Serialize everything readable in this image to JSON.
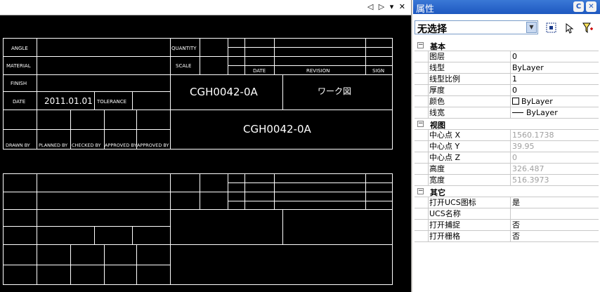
{
  "canvas": {
    "controls": "◁ ▷ ▾ ✕",
    "title_block": {
      "labels": {
        "angle": "ANGLE",
        "quantity": "QUANTITY",
        "material": "MATERIAL",
        "scale": "SCALE",
        "date_hdr": "DATE",
        "revision": "REVISION",
        "sign": "SIGN",
        "finish": "FINISH",
        "date": "DATE",
        "tolerance": "TOLERANCE",
        "drawn_by": "DRAWN BY",
        "planned_by": "PLANNED BY",
        "checked_by": "CHECKED BY",
        "approved_by_1": "APPROVED BY",
        "approved_by_2": "APPROVED BY"
      },
      "date_value": "2011.01.01",
      "part_number": "CGH0042-0A",
      "part_number_large": "CGH0042-0A",
      "doc_type": "ワーク図"
    }
  },
  "properties_panel": {
    "title": "属性",
    "selection": "无选择",
    "categories": [
      {
        "name": "基本",
        "rows": [
          {
            "key": "图层",
            "value": "0"
          },
          {
            "key": "线型",
            "value": "ByLayer"
          },
          {
            "key": "线型比例",
            "value": "1"
          },
          {
            "key": "厚度",
            "value": "0"
          },
          {
            "key": "颜色",
            "value": "ByLayer"
          },
          {
            "key": "线宽",
            "value": "ByLayer"
          }
        ]
      },
      {
        "name": "视图",
        "rows": [
          {
            "key": "中心点 X",
            "value": "1560.1738"
          },
          {
            "key": "中心点 Y",
            "value": "39.95"
          },
          {
            "key": "中心点 Z",
            "value": "0"
          },
          {
            "key": "高度",
            "value": "326.487"
          },
          {
            "key": "宽度",
            "value": "516.3973"
          }
        ]
      },
      {
        "name": "其它",
        "rows": [
          {
            "key": "打开UCS图标",
            "value": "是"
          },
          {
            "key": "UCS名称",
            "value": ""
          },
          {
            "key": "打开捕捉",
            "value": "否"
          },
          {
            "key": "打开栅格",
            "value": "否"
          }
        ]
      }
    ]
  },
  "colors": {
    "canvas_bg": "#000000",
    "line": "#ffffff",
    "text": "#ffffff",
    "title_bar": "#1e58c0"
  }
}
